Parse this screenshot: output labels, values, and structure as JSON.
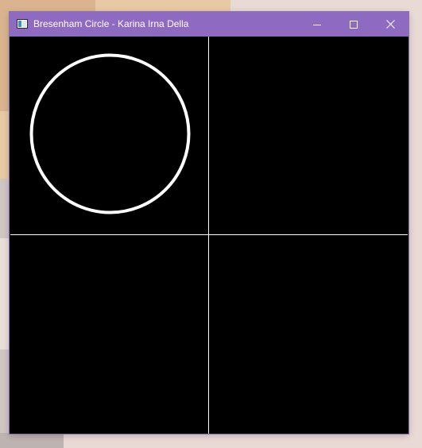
{
  "window": {
    "title": "Bresenham Circle - Karina Irna Della",
    "accent_color": "#8e6bc0",
    "icons": [
      "app-icon",
      "minimize-icon",
      "maximize-icon",
      "close-icon"
    ]
  },
  "canvas": {
    "background": "#000000",
    "line_color": "#ffffff",
    "circle_quadrant": "top-left",
    "axes": "vertical and horizontal white lines dividing canvas into quadrants"
  }
}
